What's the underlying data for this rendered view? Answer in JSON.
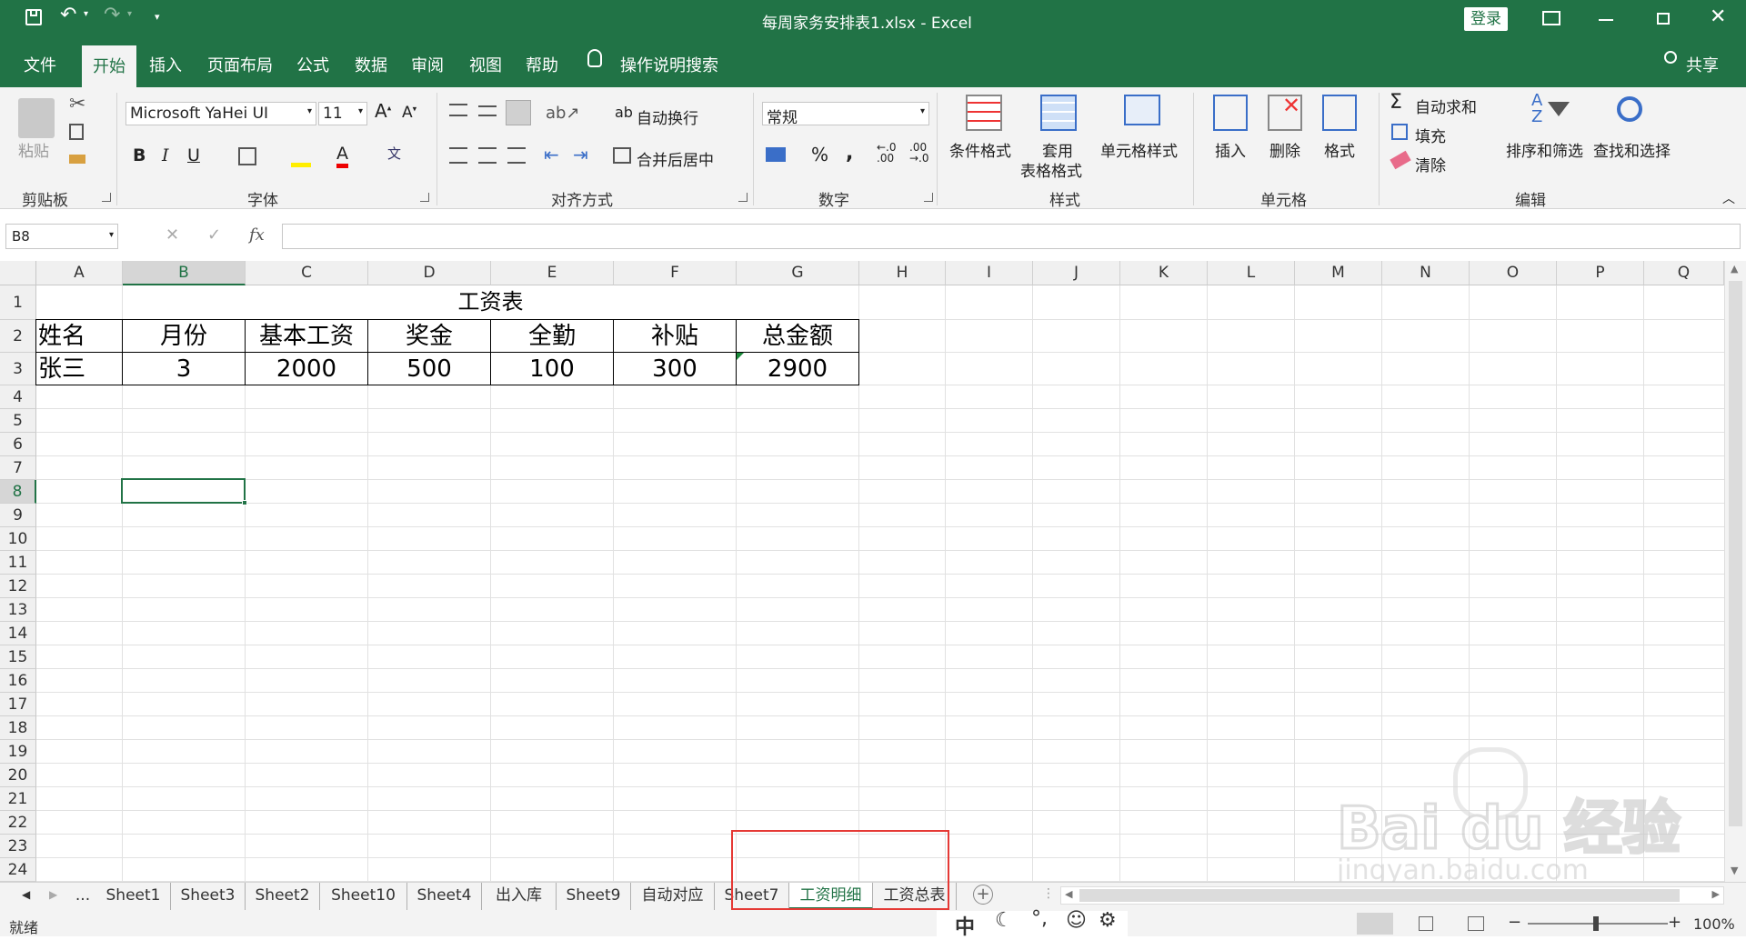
{
  "titlebar": {
    "doc_title": "每周家务安排表1.xlsx  -  Excel",
    "login_label": "登录"
  },
  "ribbon_tabs": [
    "文件",
    "开始",
    "插入",
    "页面布局",
    "公式",
    "数据",
    "审阅",
    "视图",
    "帮助"
  ],
  "tell_me": "操作说明搜索",
  "share_label": "共享",
  "clipboard": {
    "paste_label": "粘贴",
    "group_label": "剪贴板"
  },
  "font": {
    "name": "Microsoft YaHei UI",
    "size": "11",
    "group_label": "字体"
  },
  "alignment": {
    "wrap_label": "自动换行",
    "merge_label": "合并后居中",
    "group_label": "对齐方式"
  },
  "number": {
    "format": "常规",
    "group_label": "数字"
  },
  "styles": {
    "cond_label": "条件格式",
    "table_label_1": "套用",
    "table_label_2": "表格格式",
    "cell_label": "单元格样式",
    "group_label": "样式"
  },
  "cells": {
    "insert_label": "插入",
    "delete_label": "删除",
    "format_label": "格式",
    "group_label": "单元格"
  },
  "editing": {
    "autosum_label": "自动求和",
    "fill_label": "填充",
    "clear_label": "清除",
    "sort_label": "排序和筛选",
    "find_label": "查找和选择",
    "group_label": "编辑"
  },
  "formula_bar": {
    "name_box": "B8",
    "fx": "fx",
    "content": ""
  },
  "columns": [
    "A",
    "B",
    "C",
    "D",
    "E",
    "F",
    "G",
    "H",
    "I",
    "J",
    "K",
    "L",
    "M",
    "N",
    "O",
    "P",
    "Q"
  ],
  "rows": [
    "1",
    "2",
    "3",
    "4",
    "5",
    "6",
    "7",
    "8",
    "9",
    "10",
    "11",
    "12",
    "13",
    "14",
    "15",
    "16",
    "17",
    "18",
    "19",
    "20",
    "21",
    "22",
    "23",
    "24"
  ],
  "table": {
    "title": "工资表",
    "headers": [
      "姓名",
      "月份",
      "基本工资",
      "奖金",
      "全勤",
      "补贴",
      "总金额"
    ],
    "row": [
      "张三",
      "3",
      "2000",
      "500",
      "100",
      "300",
      "2900"
    ]
  },
  "sheet_tabs": [
    "...",
    "Sheet1",
    "Sheet3",
    "Sheet2",
    "Sheet10",
    "Sheet4",
    "出入库",
    "Sheet9",
    "自动对应",
    "Sheet7",
    "工资明细",
    "工资总表"
  ],
  "active_sheet": "工资明细",
  "status": {
    "ready": "就绪",
    "zoom": "100%"
  },
  "ime": {
    "mode": "中"
  },
  "watermark": {
    "brand": "Bai du 经验",
    "url": "jingyan.baidu.com"
  },
  "accent_color": "#217346",
  "highlight_color": "#e53935"
}
